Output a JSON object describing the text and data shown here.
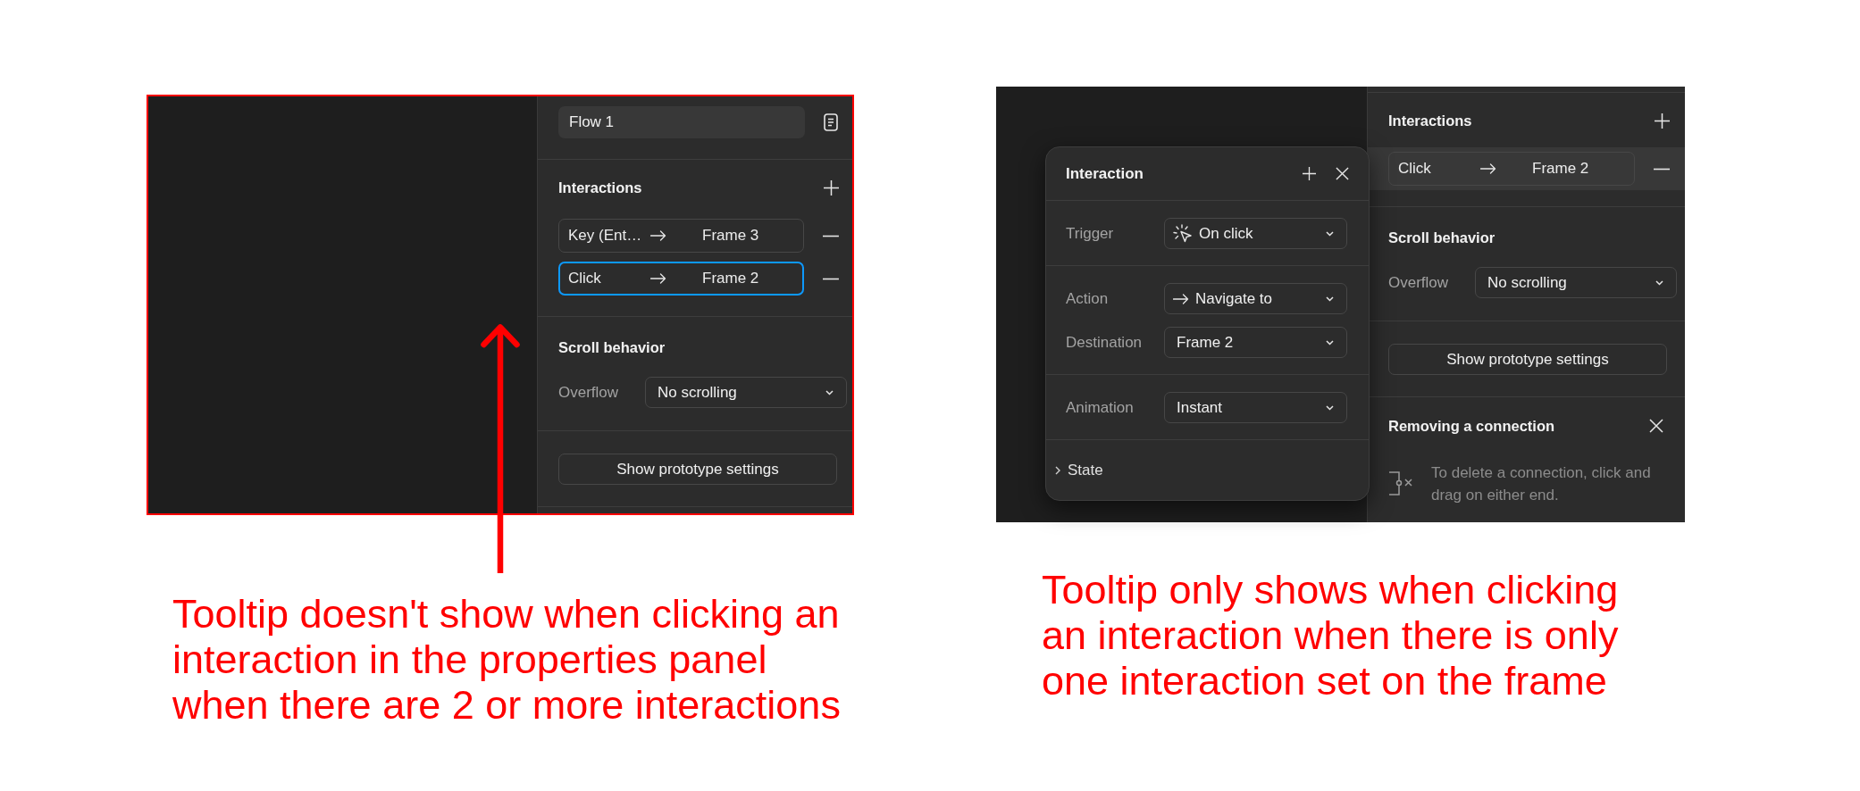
{
  "examples": [
    {
      "outlined": true,
      "pointer_arrow": true,
      "panel": {
        "scrolled": false,
        "sections": [
          {
            "kind": "flow",
            "value": "Flow 1"
          },
          {
            "kind": "interactions",
            "title": "Interactions",
            "items": [
              {
                "trigger": "Key (Ent…",
                "destination": "Frame 3",
                "selected": false,
                "focused": false
              },
              {
                "trigger": "Click",
                "destination": "Frame 2",
                "selected": false,
                "focused": true
              }
            ]
          },
          {
            "kind": "scroll",
            "title": "Scroll behavior",
            "label": "Overflow",
            "value": "No scrolling"
          },
          {
            "kind": "button",
            "label": "Show prototype settings"
          }
        ]
      },
      "caption": "Tooltip doesn't show when clicking an interaction in the properties panel when there are 2 or more interactions"
    },
    {
      "panel": {
        "scrolled": true,
        "sections": [
          {
            "kind": "interactions",
            "title": "Interactions",
            "items": [
              {
                "trigger": "Click",
                "destination": "Frame 2",
                "selected": true,
                "focused": false
              }
            ]
          },
          {
            "kind": "scroll",
            "title": "Scroll behavior",
            "label": "Overflow",
            "value": "No scrolling"
          },
          {
            "kind": "button",
            "label": "Show prototype settings"
          },
          {
            "kind": "tip",
            "title": "Removing a connection",
            "text": "To delete a connection, click and drag on either end."
          }
        ]
      },
      "popup": {
        "title": "Interaction",
        "groups": [
          {
            "fields": [
              {
                "kind": "trigger",
                "label": "Trigger",
                "value": "On click"
              }
            ]
          },
          {
            "fields": [
              {
                "kind": "action",
                "label": "Action",
                "value": "Navigate to"
              },
              {
                "kind": "plain",
                "label": "Destination",
                "value": "Frame 2"
              }
            ]
          },
          {
            "fields": [
              {
                "kind": "plain",
                "label": "Animation",
                "value": "Instant"
              }
            ]
          }
        ],
        "state": {
          "label": "State",
          "expanded": false
        }
      },
      "caption": "Tooltip only shows when clicking an interaction when there is only one interaction set on the frame"
    }
  ]
}
